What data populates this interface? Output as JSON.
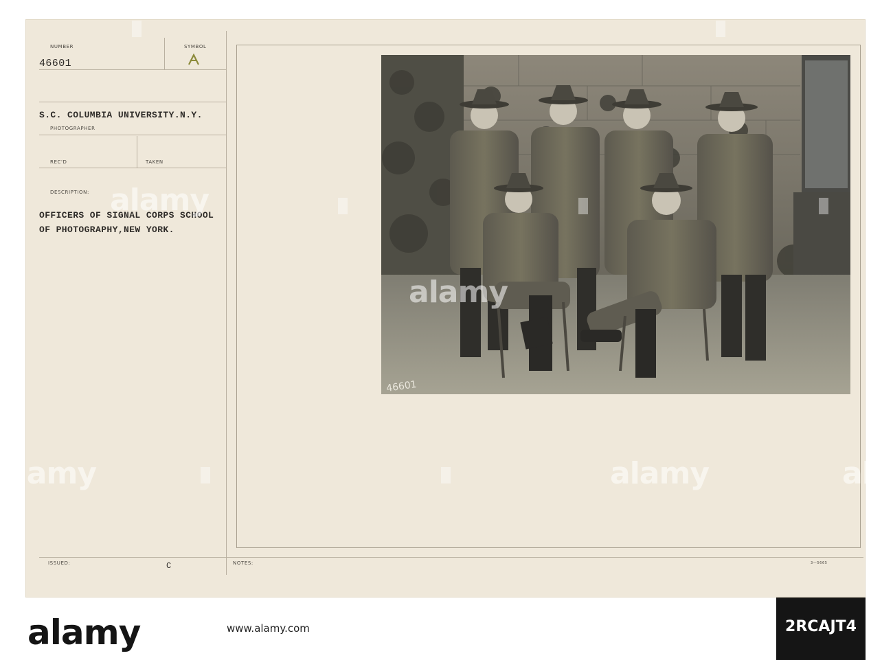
{
  "card": {
    "number_label": "NUMBER",
    "number_value": "46601",
    "symbol_label": "SYMBOL",
    "location": "S.C. COLUMBIA UNIVERSITY.N.Y.",
    "photographer_label": "PHOTOGRAPHER",
    "recd_label": "REC'D",
    "taken_label": "TAKEN",
    "description_label": "DESCRIPTION:",
    "description_line1": "OFFICERS OF SIGNAL CORPS SCHOOL",
    "description_line2": "OF PHOTOGRAPHY,NEW YORK.",
    "issued_label": "ISSUED:",
    "issued_code": "C",
    "notes_label": "NOTES:",
    "form_number": "3—5665",
    "photo_number_scratch": "46601"
  },
  "watermark": {
    "text": "alamy"
  },
  "footer": {
    "logo": "alamy",
    "image_id": "2RCAJT4",
    "url": "www.alamy.com"
  },
  "colors": {
    "card": "#efe8da",
    "ink": "#2e2b28",
    "rule": "#b9b0a0",
    "photo_dark": "#2b2a26"
  }
}
